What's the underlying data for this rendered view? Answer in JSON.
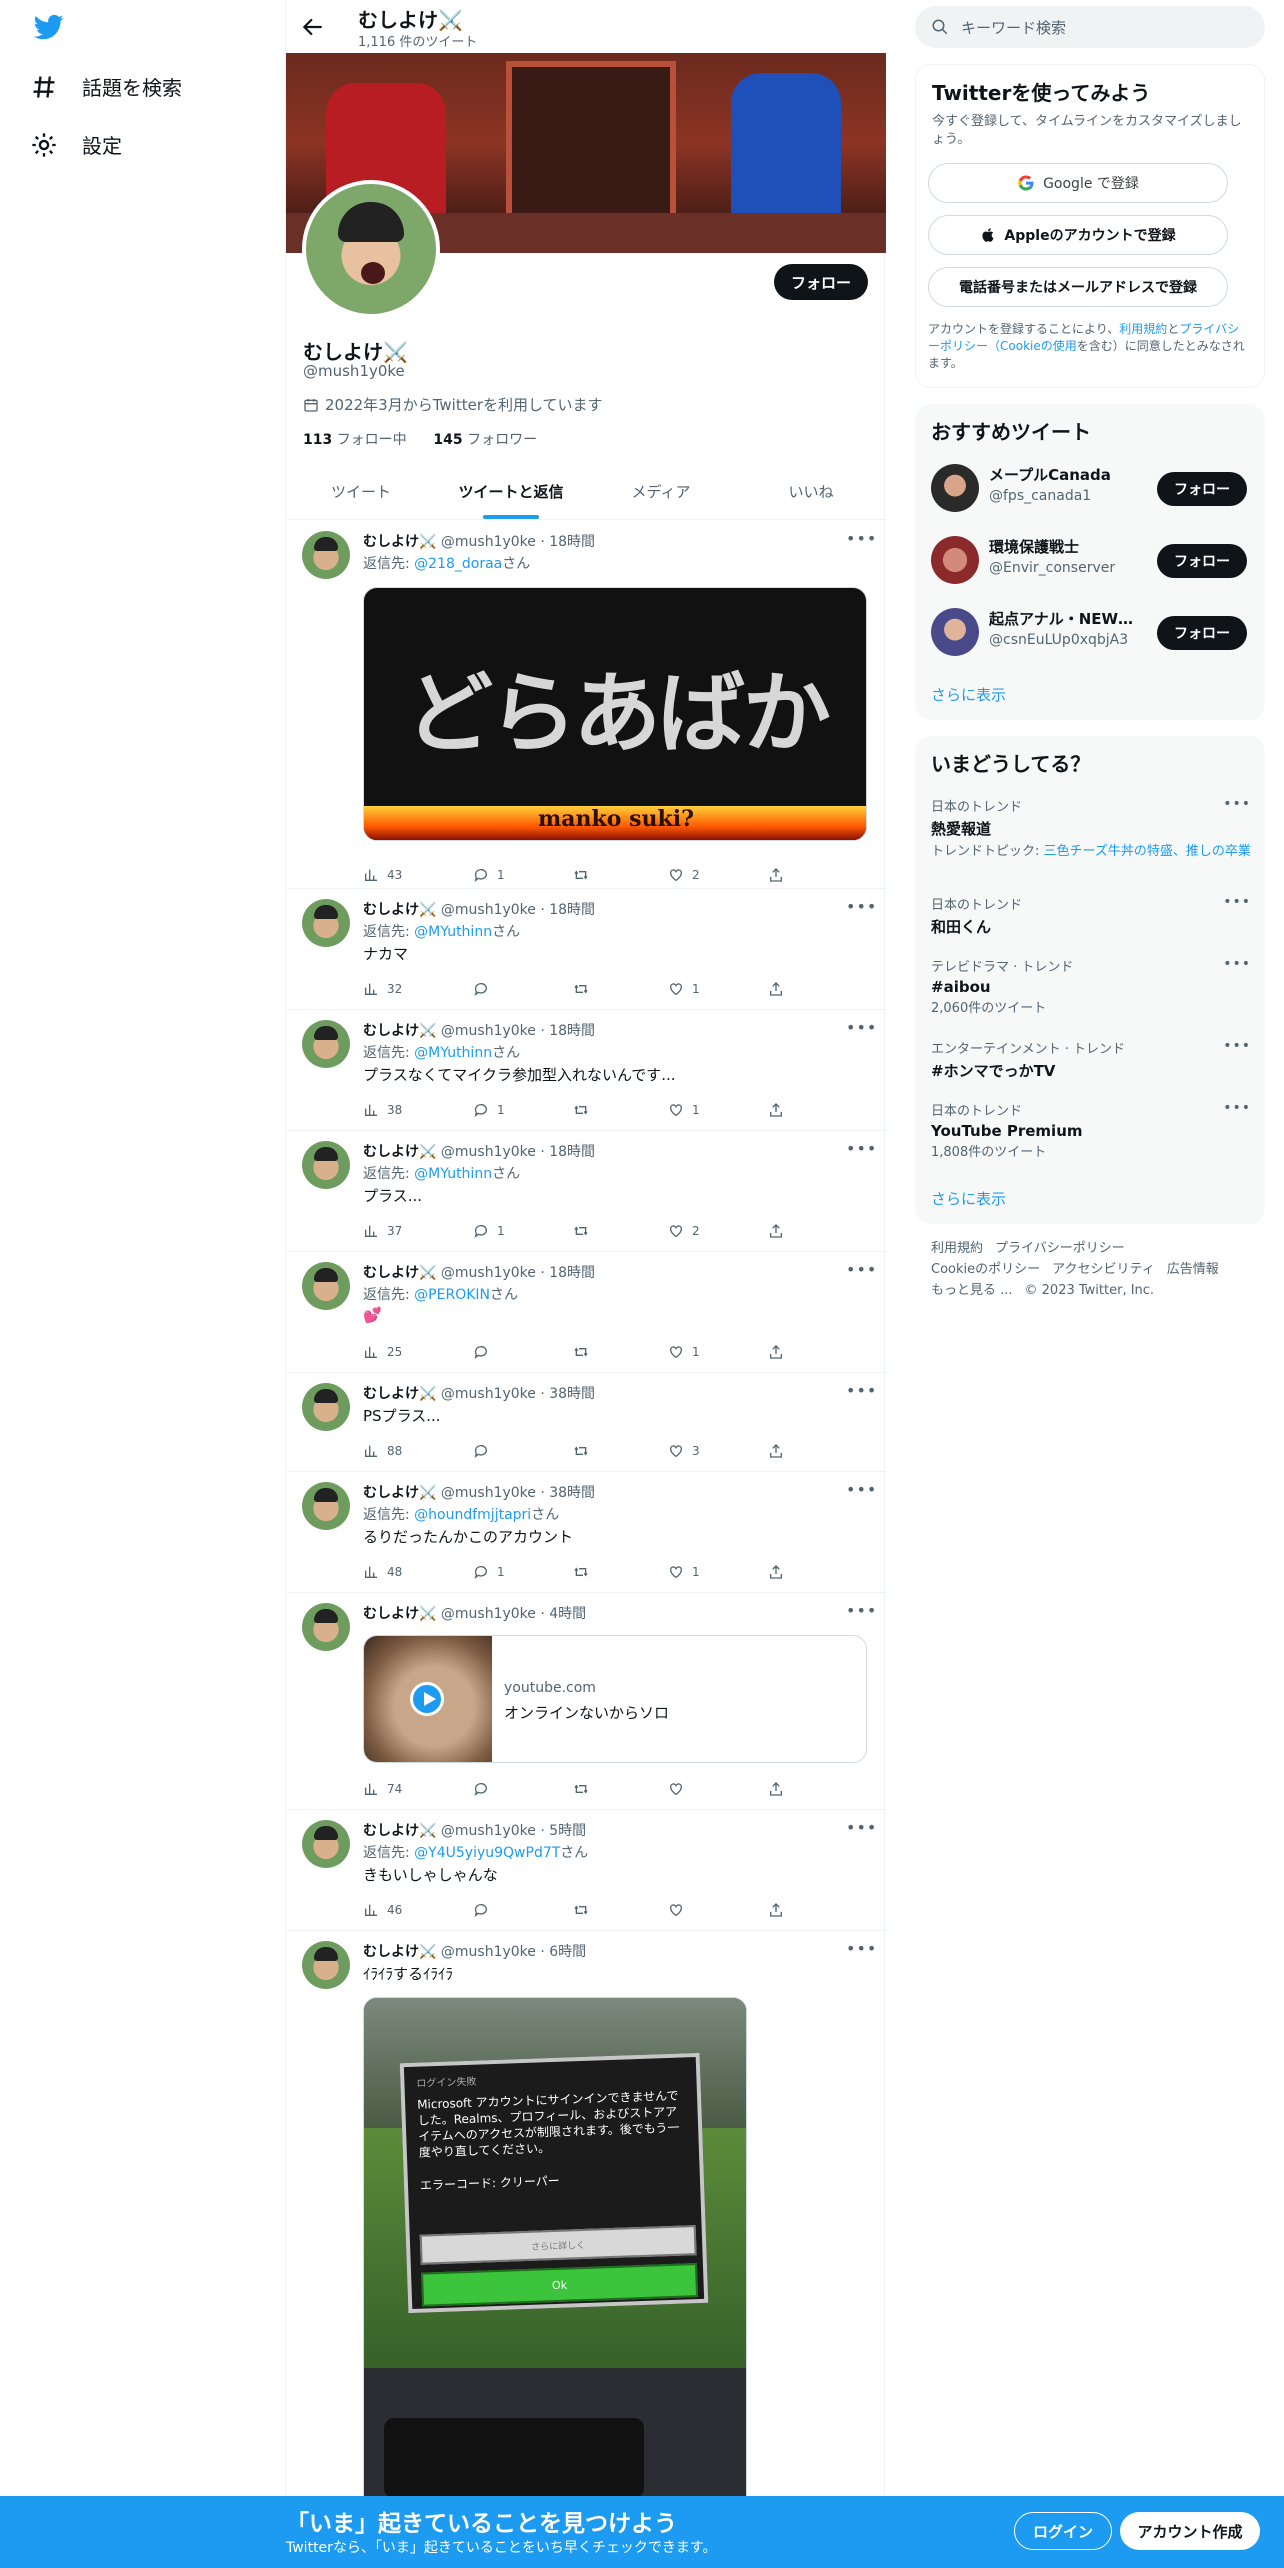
{
  "nav": {
    "explore": "話題を検索",
    "settings": "設定"
  },
  "profile": {
    "name": "むしよけ⚔️",
    "tweet_count": "1,116 件のツイート",
    "handle": "@mush1y0ke",
    "joined": "2022年3月からTwitterを利用しています",
    "following_count": "113",
    "following_label": "フォロー中",
    "followers_count": "145",
    "followers_label": "フォロワー",
    "follow_button": "フォロー"
  },
  "tabs": [
    "ツイート",
    "ツイートと返信",
    "メディア",
    "いいね"
  ],
  "reply_prefix": "返信先:",
  "reply_suffix": "さん",
  "tweets": [
    {
      "author": "むしよけ⚔️",
      "meta": "@mush1y0ke · 18時間",
      "reply_to": "@218_doraa",
      "text": "",
      "views": "43",
      "replies": "1",
      "retweets": "",
      "likes": "2",
      "image_text": "どらあばか",
      "image_subtext": "manko suki?"
    },
    {
      "author": "むしよけ⚔️",
      "meta": "@mush1y0ke · 18時間",
      "reply_to": "@MYuthinn",
      "text": "ナカマ",
      "views": "32",
      "replies": "",
      "retweets": "",
      "likes": "1"
    },
    {
      "author": "むしよけ⚔️",
      "meta": "@mush1y0ke · 18時間",
      "reply_to": "@MYuthinn",
      "text": "プラスなくてマイクラ参加型入れないんです...",
      "views": "38",
      "replies": "1",
      "retweets": "",
      "likes": "1"
    },
    {
      "author": "むしよけ⚔️",
      "meta": "@mush1y0ke · 18時間",
      "reply_to": "@MYuthinn",
      "text": "プラス...",
      "views": "37",
      "replies": "1",
      "retweets": "",
      "likes": "2"
    },
    {
      "author": "むしよけ⚔️",
      "meta": "@mush1y0ke · 18時間",
      "reply_to": "@PEROKIN",
      "text": "💕",
      "views": "25",
      "replies": "",
      "retweets": "",
      "likes": "1"
    },
    {
      "author": "むしよけ⚔️",
      "meta": "@mush1y0ke · 38時間",
      "reply_to": "",
      "text": "PSプラス...",
      "views": "88",
      "replies": "",
      "retweets": "",
      "likes": "3"
    },
    {
      "author": "むしよけ⚔️",
      "meta": "@mush1y0ke · 38時間",
      "reply_to": "@houndfmjjtapri",
      "text": "るりだったんかこのアカウント",
      "views": "48",
      "replies": "1",
      "retweets": "",
      "likes": "1"
    },
    {
      "author": "むしよけ⚔️",
      "meta": "@mush1y0ke · 4時間",
      "reply_to": "",
      "text": "",
      "views": "74",
      "replies": "",
      "retweets": "",
      "likes": "",
      "card_domain": "youtube.com",
      "card_title": "オンラインないからソロ"
    },
    {
      "author": "むしよけ⚔️",
      "meta": "@mush1y0ke · 5時間",
      "reply_to": "@Y4U5yiyu9QwPd7T",
      "text": "きもいしゃしゃんな",
      "views": "46",
      "replies": "",
      "retweets": "",
      "likes": ""
    },
    {
      "author": "むしよけ⚔️",
      "meta": "@mush1y0ke · 6時間",
      "reply_to": "",
      "text": "ｲﾗｲﾗするｲﾗｲﾗ",
      "mc_title": "ログイン失敗",
      "mc_body": "Microsoft アカウントにサインインできませんでした。Realms、プロフィール、およびストアアイテムへのアクセスが制限されます。後でもう一度やり直してください。",
      "mc_error": "エラーコード: クリーパー",
      "mc_more": "さらに詳しく",
      "mc_ok": "Ok"
    }
  ],
  "search": {
    "placeholder": "キーワード検索"
  },
  "signup": {
    "title": "Twitterを使ってみよう",
    "subtitle": "今すぐ登録して、タイムラインをカスタマイズしましょう。",
    "google": "Google で登録",
    "apple": "Appleのアカウントで登録",
    "phone": "電話番号またはメールアドレスで登録",
    "terms_pre": "アカウントを登録することにより、",
    "terms_link1": "利用規約",
    "terms_mid": "と",
    "terms_link2": "プライバシーポリシー（Cookieの使用",
    "terms_post": "を含む）に同意したとみなされます。"
  },
  "recommend": {
    "title": "おすすめツイート",
    "users": [
      {
        "name": "メープルCanada",
        "handle": "@fps_canada1",
        "button": "フォロー"
      },
      {
        "name": "環境保護戦士",
        "handle": "@Envir_conserver",
        "button": "フォロー"
      },
      {
        "name": "起点アナル・NEWS...",
        "handle": "@csnEuLUp0xqbjA3",
        "button": "フォロー"
      }
    ],
    "more": "さらに表示"
  },
  "trends": {
    "title": "いまどうしてる？",
    "items": [
      {
        "category": "日本のトレンド",
        "title": "熱愛報道",
        "sub": "トレンドトピック: ",
        "sub_link": "三色チーズ牛丼の特盛、推しの卒業"
      },
      {
        "category": "日本のトレンド",
        "title": "和田くん",
        "sub": ""
      },
      {
        "category": "テレビドラマ · トレンド",
        "title": "#aibou",
        "sub": "2,060件のツイート"
      },
      {
        "category": "エンターテインメント · トレンド",
        "title": "#ホンマでっかTV",
        "sub": ""
      },
      {
        "category": "日本のトレンド",
        "title": "YouTube Premium",
        "sub": "1,808件のツイート"
      }
    ],
    "more": "さらに表示"
  },
  "footer": {
    "terms": "利用規約",
    "privacy": "プライバシーポリシー",
    "cookie": "Cookieのポリシー",
    "access": "アクセシビリティ",
    "ads": "広告情報",
    "more": "もっと見る ...",
    "copyright": "© 2023 Twitter, Inc."
  },
  "bottom": {
    "title": "「いま」起きていることを見つけよう",
    "subtitle": "Twitterなら、「いま」起きていることをいち早くチェックできます。",
    "login": "ログイン",
    "signup": "アカウント作成"
  }
}
